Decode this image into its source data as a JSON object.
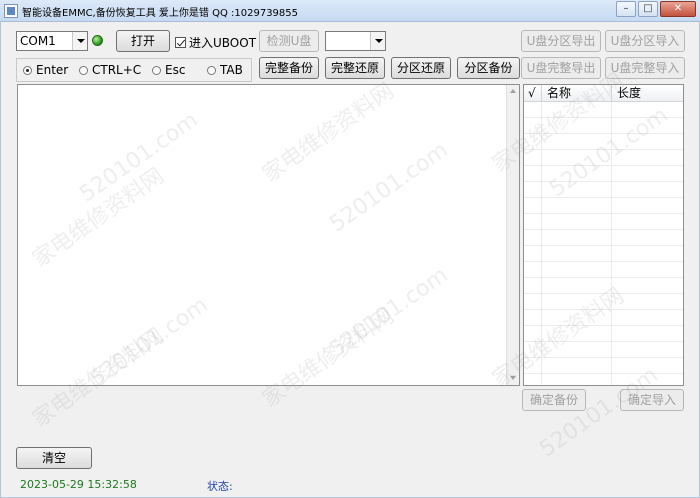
{
  "window": {
    "title": "智能设备EMMC,备份恢复工具   爱上你是错 QQ :1029739855",
    "controls": {
      "minimize": "–",
      "maximize": "□",
      "close": "✕"
    }
  },
  "toolbar": {
    "port_value": "COM1",
    "open_label": "打开",
    "enter_uboot_label": "进入UBOOT",
    "detect_usb_label": "检测U盘",
    "drive_value": "",
    "usb_partition_export_label": "U盘分区导出",
    "usb_partition_import_label": "U盘分区导入",
    "full_backup_label": "完整备份",
    "full_restore_label": "完整还原",
    "partition_restore_label": "分区还原",
    "partition_backup_label": "分区备份",
    "usb_full_export_label": "U盘完整导出",
    "usb_full_import_label": "U盘完整导入"
  },
  "radio_group": {
    "options": [
      "Enter",
      "CTRL+C",
      "Esc",
      "TAB"
    ],
    "selected": "Enter"
  },
  "enter_uboot_checked": true,
  "partition_list": {
    "columns": [
      "√",
      "名称",
      "长度"
    ]
  },
  "bottom": {
    "confirm_backup_label": "确定备份",
    "confirm_import_label": "确定导入",
    "clear_label": "清空"
  },
  "status_bar": {
    "datetime": "2023-05-29 15:32:58",
    "status_label": "状态:"
  },
  "watermark": {
    "text_1": "家电维修资料网",
    "text_2": "520101.com"
  },
  "colors": {
    "led": "#2e9c1c",
    "datetime": "#1b7a1b",
    "status_label": "#1a3fb0"
  }
}
